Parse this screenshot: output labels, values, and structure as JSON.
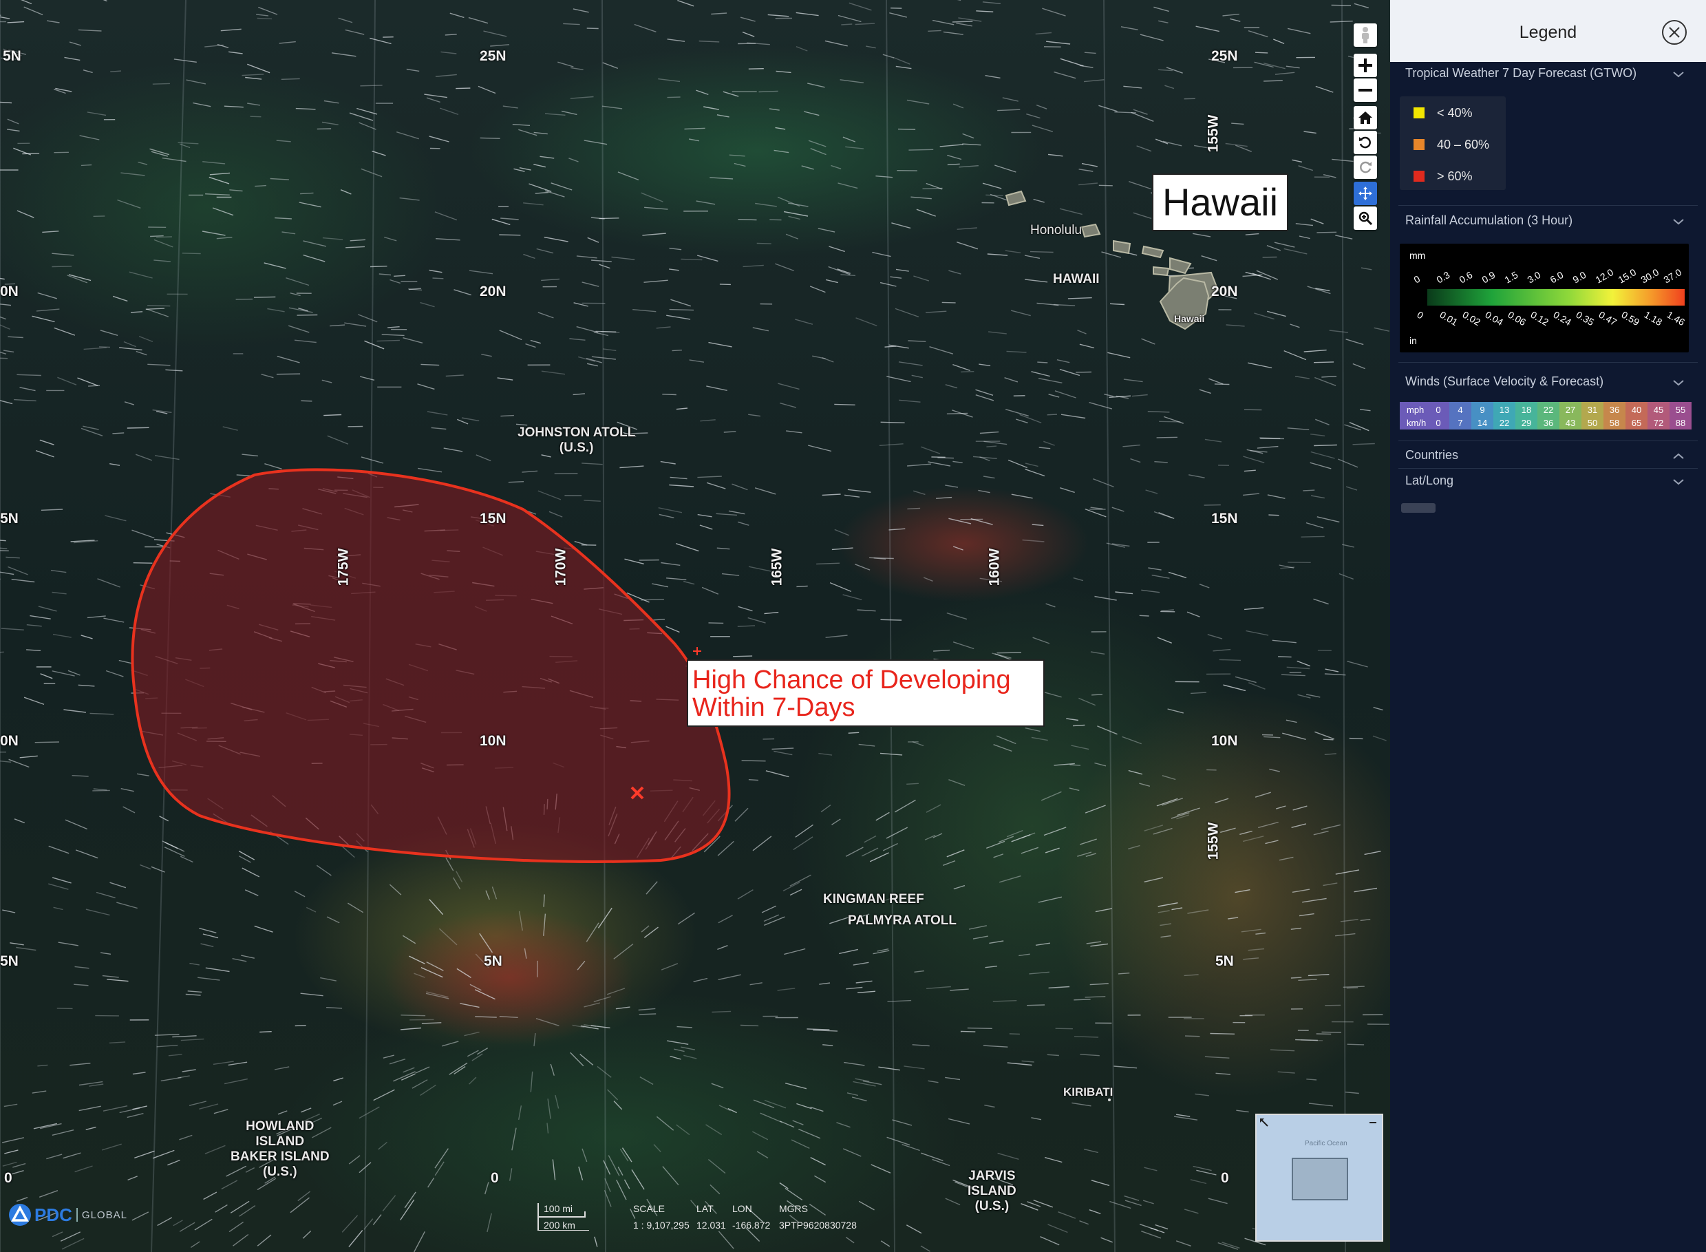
{
  "map": {
    "lat_labels": [
      {
        "text": "25N",
        "side": "left"
      },
      {
        "text": "25N",
        "side": "right"
      },
      {
        "text": "5N",
        "side": "edge"
      },
      {
        "text": "20N",
        "side": "left"
      },
      {
        "text": "20N",
        "side": "right"
      },
      {
        "text": "0N",
        "side": "edge"
      },
      {
        "text": "15N",
        "side": "left"
      },
      {
        "text": "15N",
        "side": "right"
      },
      {
        "text": "5N",
        "side": "edge"
      },
      {
        "text": "10N",
        "side": "left"
      },
      {
        "text": "10N",
        "side": "right"
      },
      {
        "text": "0N",
        "side": "edge"
      },
      {
        "text": "5N",
        "side": "left"
      },
      {
        "text": "5N",
        "side": "right"
      },
      {
        "text": "5N",
        "side": "edge"
      },
      {
        "text": "0",
        "side": "left"
      },
      {
        "text": "0",
        "side": "right"
      },
      {
        "text": "0",
        "side": "edge"
      }
    ],
    "lon_labels": [
      "175W",
      "170W",
      "165W",
      "160W",
      "155W",
      "155W"
    ],
    "places": {
      "johnston": "JOHNSTON ATOLL\n(U.S.)",
      "honolulu": "Honolulu",
      "hawaii_state": "HAWAII",
      "hawaii_island": "Hawaii",
      "kingman": "KINGMAN REEF",
      "palmyra": "PALMYRA ATOLL",
      "kiribati": "KIRIBATI",
      "howland": "HOWLAND\nISLAND\nBAKER ISLAND\n(U.S.)",
      "jarvis": "JARVIS\nISLAND\n(U.S.)"
    },
    "callouts": {
      "hawaii": "Hawaii",
      "development_line1": "High Chance of Developing",
      "development_line2": "Within 7-Days"
    },
    "outlook_area": {
      "chance": "> 60%",
      "outline_color": "#e8321e",
      "fill_color": "#7a1a22"
    },
    "logo": {
      "pdc": "PDC",
      "global": "GLOBAL"
    },
    "minimap": {
      "ocean_label": "Pacific Ocean"
    }
  },
  "status": {
    "scale_mi": "100 mi",
    "scale_km": "200 km",
    "scale_label": "SCALE",
    "scale_value": "1 : 9,107,295",
    "lat_label": "LAT",
    "lat_value": "12.031",
    "lon_label": "LON",
    "lon_value": "-166.872",
    "mgrs_label": "MGRS",
    "mgrs_value": "3PTP9620830728"
  },
  "tools": [
    "street-view-icon",
    "zoom-in-icon",
    "zoom-out-icon",
    "home-icon",
    "rotate-left-icon",
    "rotate-right-icon",
    "pan-icon",
    "zoom-box-icon"
  ],
  "legend": {
    "title": "Legend",
    "sections": {
      "gtwo": {
        "title": "Tropical Weather 7 Day Forecast (GTWO)",
        "items": [
          {
            "label": "< 40%",
            "color": "#f2e600"
          },
          {
            "label": "40 – 60%",
            "color": "#e8862a"
          },
          {
            "label": "> 60%",
            "color": "#e02a1e"
          }
        ]
      },
      "rain": {
        "title": "Rainfall Accumulation (3 Hour)",
        "unit_top": "mm",
        "unit_bottom": "in",
        "mm_ticks": [
          "0",
          "0.3",
          "0.6",
          "0.9",
          "1.5",
          "3.0",
          "6.0",
          "9.0",
          "12.0",
          "15.0",
          "30.0",
          "37.0"
        ],
        "in_ticks": [
          "0",
          "0.01",
          "0.02",
          "0.04",
          "0.06",
          "0.12",
          "0.24",
          "0.35",
          "0.47",
          "0.59",
          "1.18",
          "1.46"
        ]
      },
      "winds": {
        "title": "Winds (Surface Velocity & Forecast)",
        "mph_label": "mph",
        "kmh_label": "km/h",
        "mph": [
          "0",
          "4",
          "9",
          "13",
          "18",
          "22",
          "27",
          "31",
          "36",
          "40",
          "45",
          "55"
        ],
        "kmh": [
          "0",
          "7",
          "14",
          "22",
          "29",
          "36",
          "43",
          "50",
          "58",
          "65",
          "72",
          "88"
        ],
        "colors": [
          "#6b5bb8",
          "#5573c0",
          "#4790c4",
          "#3fa8b5",
          "#47b49a",
          "#5bb77c",
          "#89b85c",
          "#b3a84e",
          "#c6874c",
          "#c46a58",
          "#b25a7a",
          "#9a4e8f"
        ]
      },
      "countries": {
        "title": "Countries"
      },
      "latlong": {
        "title": "Lat/Long"
      }
    }
  }
}
